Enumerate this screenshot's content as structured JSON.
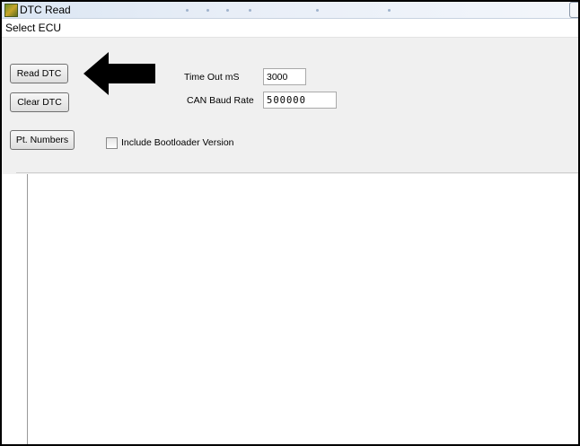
{
  "window": {
    "title": "DTC Read",
    "icon": "app-icon",
    "accent": "#dbe6f3"
  },
  "menu": {
    "select_ecu": "Select ECU"
  },
  "buttons": {
    "read_dtc": "Read DTC",
    "clear_dtc": "Clear DTC",
    "pt_numbers": "Pt. Numbers"
  },
  "fields": {
    "timeout_label": "Time Out mS",
    "timeout_value": "3000",
    "baud_label": "CAN Baud Rate",
    "baud_value": "500000"
  },
  "options": {
    "include_bootloader_label": "Include Bootloader Version",
    "include_bootloader_checked": false
  },
  "annotation": {
    "arrow": "left-arrow-icon",
    "arrow_color": "#000000"
  }
}
